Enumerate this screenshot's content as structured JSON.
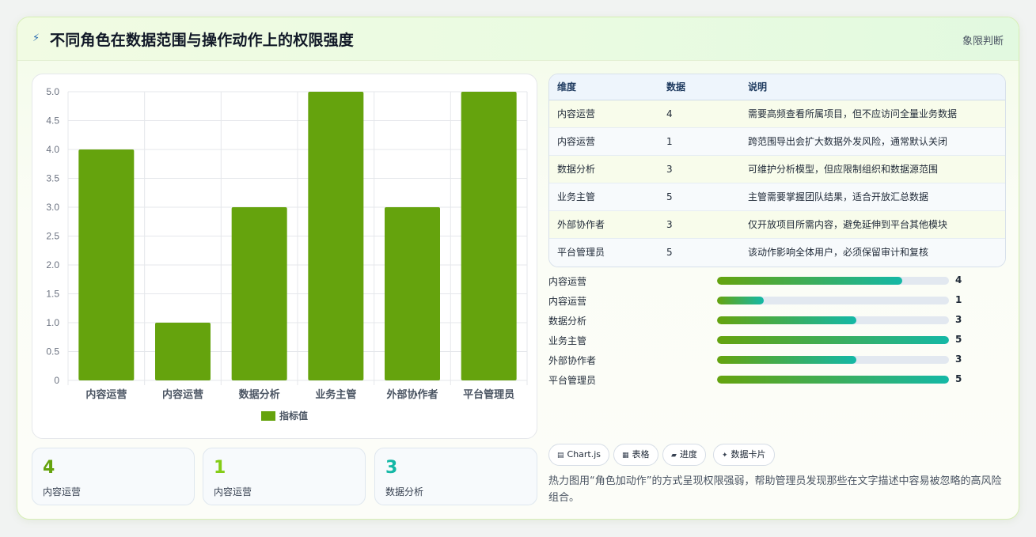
{
  "header": {
    "icon": "bolt-icon",
    "title": "不同角色在数据范围与操作动作上的权限强度",
    "tag": "象限判断"
  },
  "chart_data": {
    "type": "bar",
    "categories": [
      "内容运营",
      "内容运营",
      "数据分析",
      "业务主管",
      "外部协作者",
      "平台管理员"
    ],
    "series": [
      {
        "name": "指标值",
        "values": [
          4,
          1,
          3,
          5,
          3,
          5
        ]
      }
    ],
    "ylim": [
      0,
      5
    ],
    "yticks": [
      "0",
      "0.5",
      "1.0",
      "1.5",
      "2.0",
      "2.5",
      "3.0",
      "3.5",
      "4.0",
      "4.5",
      "5.0"
    ],
    "grid": true,
    "legend": "bottom",
    "color": "#65a30d"
  },
  "kpis": [
    {
      "value": "4",
      "label": "内容运营",
      "color": "#65a30d"
    },
    {
      "value": "1",
      "label": "内容运营",
      "color": "#84cc16"
    },
    {
      "value": "3",
      "label": "数据分析",
      "color": "#14b8a6"
    }
  ],
  "table": {
    "headers": [
      "维度",
      "数据",
      "说明"
    ],
    "rows": [
      [
        "内容运营",
        "4",
        "需要高频查看所属项目，但不应访问全量业务数据"
      ],
      [
        "内容运营",
        "1",
        "跨范围导出会扩大数据外发风险，通常默认关闭"
      ],
      [
        "数据分析",
        "3",
        "可维护分析模型，但应限制组织和数据源范围"
      ],
      [
        "业务主管",
        "5",
        "主管需要掌握团队结果，适合开放汇总数据"
      ],
      [
        "外部协作者",
        "3",
        "仅开放项目所需内容，避免延伸到平台其他模块"
      ],
      [
        "平台管理员",
        "5",
        "该动作影响全体用户，必须保留审计和复核"
      ]
    ]
  },
  "progress": {
    "max": 5,
    "items": [
      {
        "label": "内容运营",
        "value": 4,
        "text": "4"
      },
      {
        "label": "内容运营",
        "value": 1,
        "text": "1"
      },
      {
        "label": "数据分析",
        "value": 3,
        "text": "3"
      },
      {
        "label": "业务主管",
        "value": 5,
        "text": "5"
      },
      {
        "label": "外部协作者",
        "value": 3,
        "text": "3"
      },
      {
        "label": "平台管理员",
        "value": 5,
        "text": "5"
      }
    ]
  },
  "chips": [
    {
      "icon": "chart-icon",
      "glyph": "▤",
      "label": "Chart.js"
    },
    {
      "icon": "table-icon",
      "glyph": "▦",
      "label": "表格"
    },
    {
      "icon": "progress-icon",
      "glyph": "▰",
      "label": "进度"
    },
    {
      "icon": "sparkle-icon",
      "glyph": "✦",
      "label": "数据卡片"
    }
  ],
  "note": "热力图用“角色加动作”的方式呈现权限强弱，帮助管理员发现那些在文字描述中容易被忽略的高风险组合。"
}
